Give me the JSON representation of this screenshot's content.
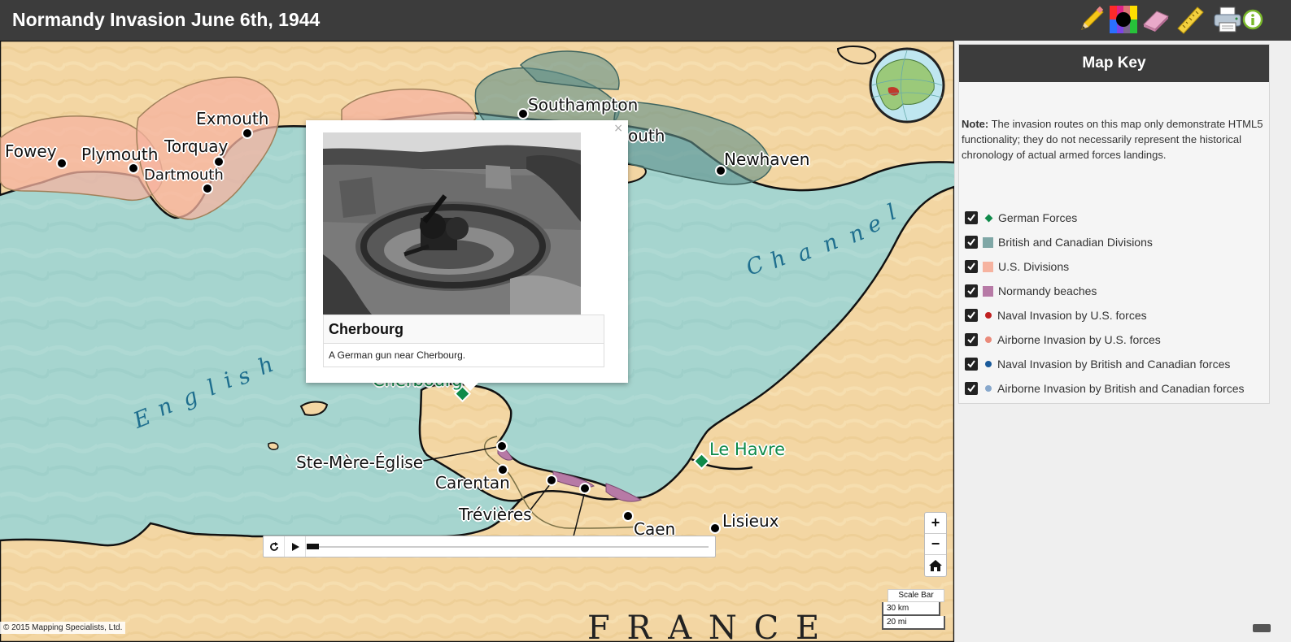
{
  "header": {
    "title": "Normandy Invasion June 6th, 1944",
    "tools": [
      "pencil-icon",
      "color-wheel-icon",
      "eraser-icon",
      "ruler-icon",
      "printer-icon",
      "info-icon"
    ]
  },
  "map": {
    "sea_name_1": "English",
    "sea_name_2": "Channel",
    "country_label": "F R A N C E",
    "cities": {
      "fowey": "Fowey",
      "plymouth": "Plymouth",
      "exmouth": "Exmouth",
      "torquay": "Torquay",
      "dartmouth": "Dartmouth",
      "southampton": "Southampton",
      "portsmouth_partial": "outh",
      "newhaven": "Newhaven",
      "cherbourg": "Cherbourg",
      "ste_mere_eglise": "Ste-Mère-Église",
      "carentan": "Carentan",
      "trevieres": "Trévières",
      "caen": "Caen",
      "lisieux": "Lisieux",
      "le_havre": "Le Havre"
    },
    "copyright": "© 2015 Mapping Specialists, Ltd.",
    "zoom": {
      "in": "+",
      "out": "−"
    },
    "scale": {
      "label": "Scale Bar",
      "km": "30 km",
      "mi": "20 mi"
    },
    "timeline": {
      "progress": 0.03
    }
  },
  "popup": {
    "title": "Cherbourg",
    "description": "A German gun near Cherbourg.",
    "close": "×"
  },
  "map_key": {
    "title": "Map Key",
    "note_label": "Note:",
    "note_text": " The invasion routes on this map only demonstrate HTML5 functionality; they do not necessarily represent the historical chronology of actual armed forces landings.",
    "items": [
      {
        "label": "German Forces",
        "color": "#0f8a4a",
        "shape": "diamond",
        "checked": true
      },
      {
        "label": "British and Canadian Divisions",
        "color": "#7fa7a6",
        "shape": "square",
        "checked": true
      },
      {
        "label": "U.S. Divisions",
        "color": "#f6b3a0",
        "shape": "square",
        "checked": true
      },
      {
        "label": "Normandy beaches",
        "color": "#b77aa6",
        "shape": "square",
        "checked": true
      },
      {
        "label": "Naval Invasion by U.S. forces",
        "color": "#c02020",
        "shape": "dot",
        "checked": true
      },
      {
        "label": "Airborne Invasion by U.S. forces",
        "color": "#ea8a7a",
        "shape": "dot",
        "checked": true
      },
      {
        "label": "Naval Invasion by British and Canadian forces",
        "color": "#1a5a9a",
        "shape": "dot",
        "checked": true
      },
      {
        "label": "Airborne Invasion by British and Canadian forces",
        "color": "#88a8cc",
        "shape": "dot",
        "checked": true
      }
    ]
  }
}
